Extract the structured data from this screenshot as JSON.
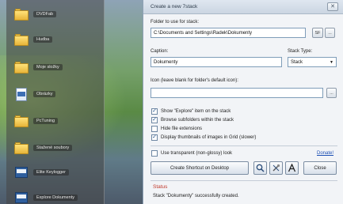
{
  "stack_items": [
    {
      "label": "DVDFab",
      "icon": "folder-icon"
    },
    {
      "label": "Hudba",
      "icon": "folder-icon"
    },
    {
      "label": "Moje složky",
      "icon": "folder-icon"
    },
    {
      "label": "Obrázky",
      "icon": "document-icon"
    },
    {
      "label": "PcTuning",
      "icon": "folder-icon"
    },
    {
      "label": "Stažené soubory",
      "icon": "folder-icon"
    },
    {
      "label": "Elite Keylogger",
      "icon": "app-icon"
    },
    {
      "label": "Explore Dokumenty",
      "icon": "app-icon"
    }
  ],
  "dialog": {
    "title": "Create a new 7stack",
    "close_label": "✕",
    "folder_label": "Folder to use for stack:",
    "folder_value": "C:\\Documents and Settings\\Radek\\Dokumenty",
    "browse_sf": "SF",
    "browse_dots": "...",
    "caption_label": "Caption:",
    "caption_value": "Dokumenty",
    "stack_type_label": "Stack Type:",
    "stack_type_value": "Stack",
    "icon_label": "Icon (leave blank for folder's default icon):",
    "icon_value": "",
    "icon_browse": "...",
    "options": [
      {
        "label": "Show \"Explore\" item on the stack",
        "checked": true
      },
      {
        "label": "Browse subfolders within the stack",
        "checked": true
      },
      {
        "label": "Hide file extensions",
        "checked": false
      },
      {
        "label": "Display thumbnails of images in Grid (slower)",
        "checked": true
      }
    ],
    "transparent_label": "Use transparent (non-glossy) look",
    "transparent_checked": false,
    "donate_label": "Donate!",
    "create_button": "Create Shortcut on Desktop",
    "close_button": "Close",
    "status_title": "Status",
    "status_text": "Stack \"Dokumenty\" successfully created."
  },
  "colors": {
    "accent_link": "#1c4fb4",
    "status_red": "#c0392b"
  }
}
